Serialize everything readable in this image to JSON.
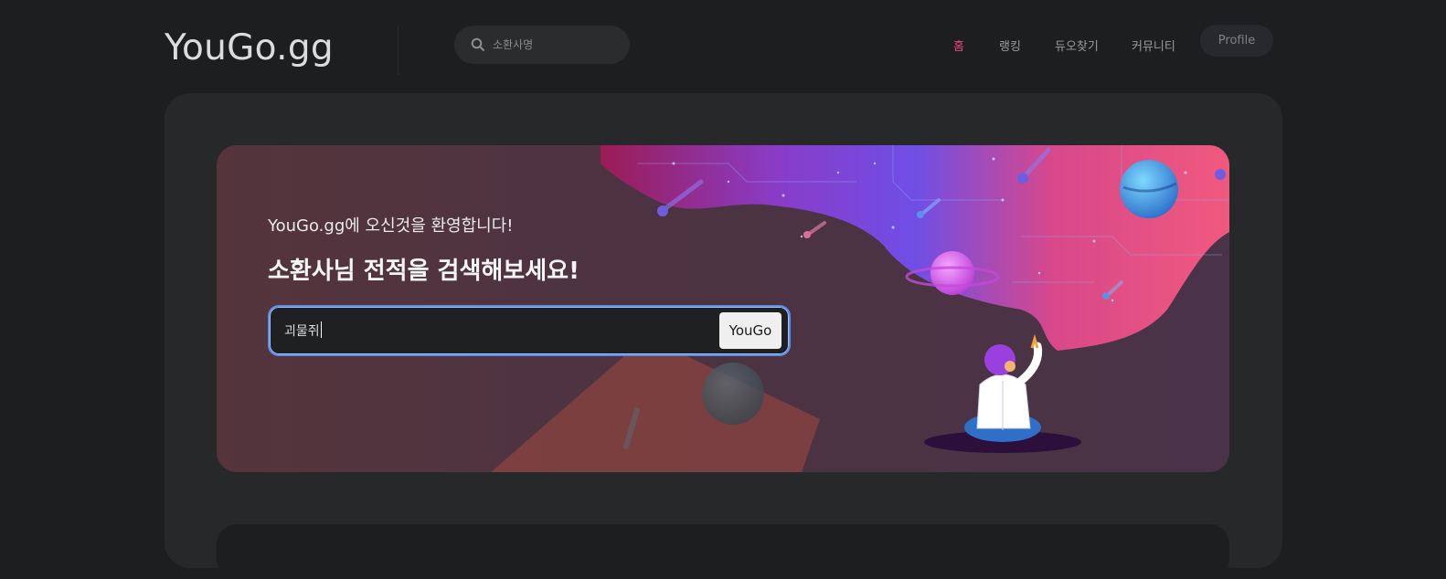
{
  "header": {
    "logo": "YouGo.gg",
    "search_placeholder": "소환사명",
    "nav": [
      {
        "label": "홈",
        "active": true
      },
      {
        "label": "랭킹",
        "active": false
      },
      {
        "label": "듀오찾기",
        "active": false
      },
      {
        "label": "커뮤니티",
        "active": false
      }
    ],
    "profile_label": "Profile"
  },
  "hero": {
    "welcome": "YouGo.gg에 오신것을 환영합니다!",
    "headline": "소환사님 전적을 검색해보세요!",
    "search_value": "괴물쥐",
    "search_button": "YouGo"
  },
  "colors": {
    "accent": "#e8467c",
    "focus_border": "#5b8fe6"
  },
  "icons": [
    "search-icon"
  ]
}
